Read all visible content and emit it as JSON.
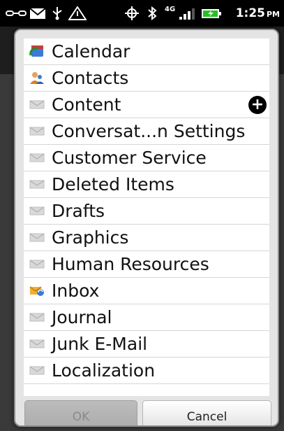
{
  "status_bar": {
    "network_label": "4G",
    "time": "1:25",
    "ampm": "PM"
  },
  "dialog": {
    "items": [
      {
        "label": "Calendar",
        "icon": "calendar-folder-icon"
      },
      {
        "label": "Contacts",
        "icon": "contacts-folder-icon"
      },
      {
        "label": "Content",
        "icon": "mail-folder-icon"
      },
      {
        "label": "Conversat...n Settings",
        "icon": "mail-folder-icon"
      },
      {
        "label": "Customer Service",
        "icon": "mail-folder-icon"
      },
      {
        "label": "Deleted Items",
        "icon": "mail-folder-icon"
      },
      {
        "label": "Drafts",
        "icon": "mail-folder-icon"
      },
      {
        "label": "Graphics",
        "icon": "mail-folder-icon"
      },
      {
        "label": "Human Resources",
        "icon": "mail-folder-icon"
      },
      {
        "label": "Inbox",
        "icon": "inbox-folder-icon"
      },
      {
        "label": "Journal",
        "icon": "mail-folder-icon"
      },
      {
        "label": "Junk E-Mail",
        "icon": "mail-folder-icon"
      },
      {
        "label": "Localization",
        "icon": "mail-folder-icon"
      }
    ],
    "expand_icon": "plus-circle-icon",
    "ok_label": "OK",
    "cancel_label": "Cancel"
  },
  "colors": {
    "dialog_bg": "#e4e4e4",
    "list_bg": "#ffffff",
    "separator": "#d6d6d6",
    "disabled_text": "#8a8a8a"
  }
}
